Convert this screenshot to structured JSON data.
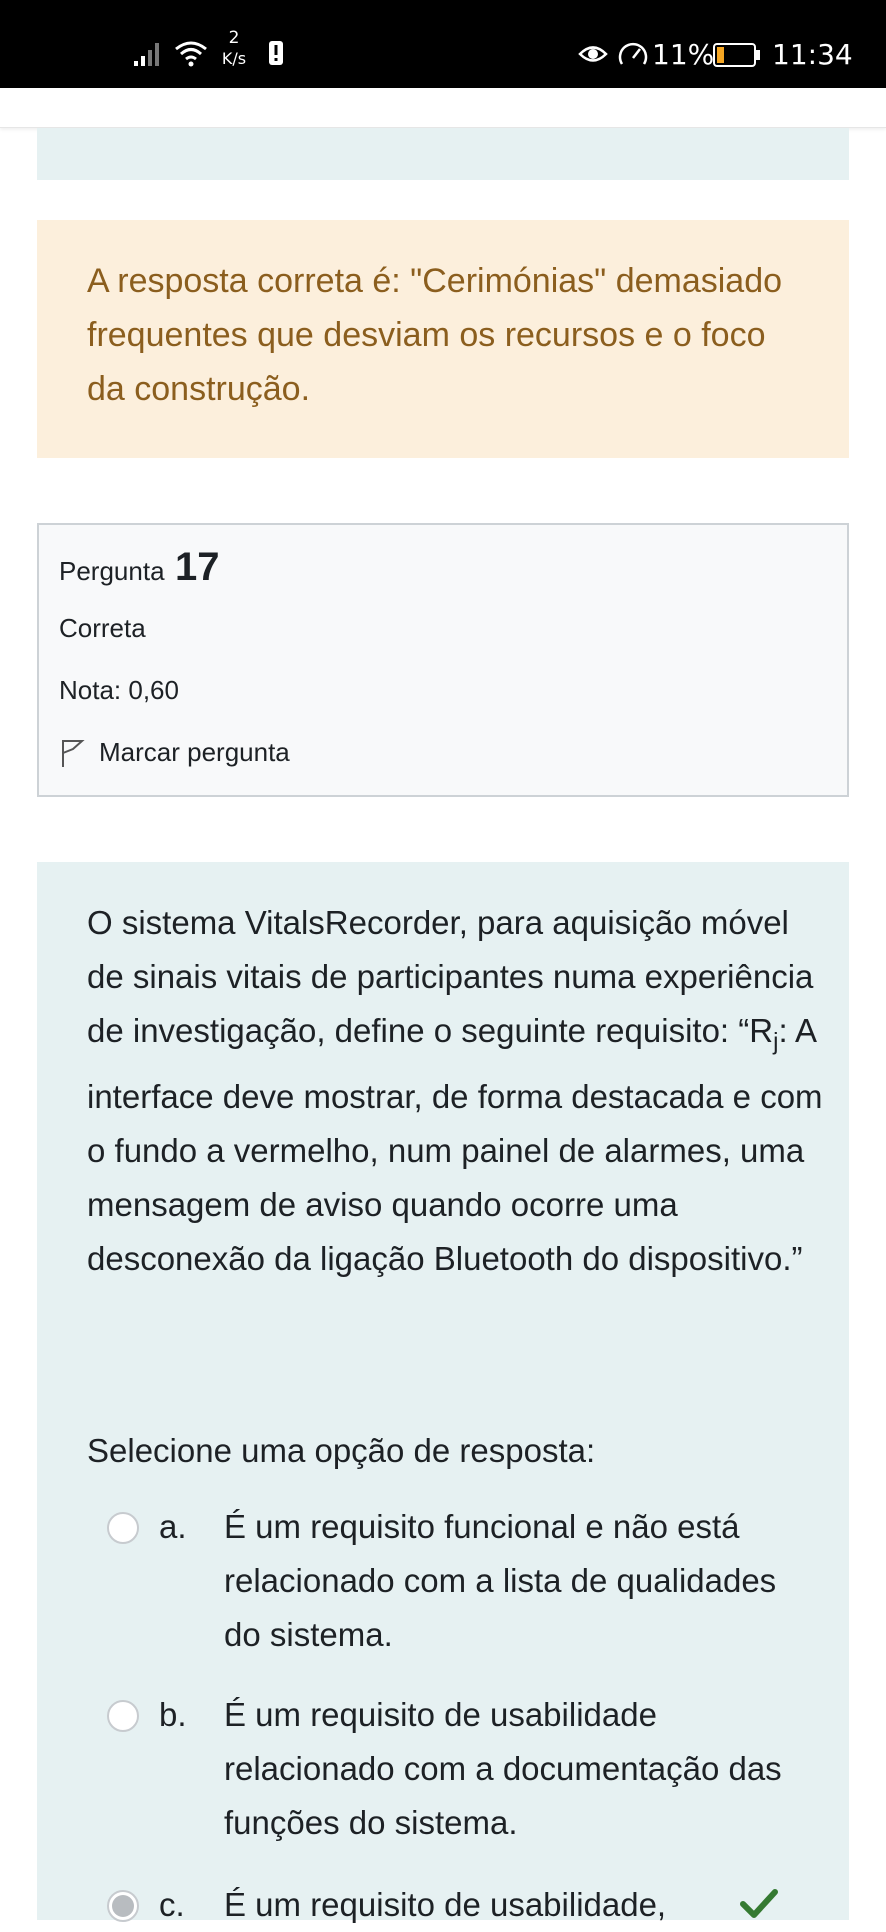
{
  "status_bar": {
    "net_speed_value": "2",
    "net_speed_unit": "K/s",
    "battery_percent": "11%",
    "time": "11:34"
  },
  "feedback": {
    "text": "A resposta correta é: \"Cerimónias\" demasiado frequentes que desviam os recursos e o foco da construção."
  },
  "question_info": {
    "label": "Pergunta",
    "number": "17",
    "state": "Correta",
    "grade": "Nota: 0,60",
    "flag_label": "Marcar pergunta"
  },
  "question": {
    "text_before": "O sistema VitalsRecorder, para aquisição móvel de sinais vitais de participantes numa experiência de investigação, define o seguinte requisito: “R",
    "text_sub": "j",
    "text_after": ": A interface deve mostrar, de forma destacada e com o fundo a vermelho, num painel  de alarmes, uma mensagem de aviso quando ocorre uma desconexão da ligação Bluetooth do dispositivo.”",
    "prompt": "Selecione uma opção de resposta:",
    "answers": [
      {
        "letter": "a.",
        "text": "É um requisito funcional e não está relacionado com a lista de qualidades do sistema.",
        "selected": false
      },
      {
        "letter": "b.",
        "text": "É um requisito de usabilidade relacionado com a documentação das funções do sistema.",
        "selected": false
      },
      {
        "letter": "c.",
        "text": "É um requisito de usabilidade,",
        "selected": true,
        "correct": true
      }
    ]
  },
  "colors": {
    "feedback_bg": "#fcefdc",
    "feedback_text": "#8b5e1e",
    "question_bg": "#e6f1f2",
    "correct_check": "#357a32"
  }
}
